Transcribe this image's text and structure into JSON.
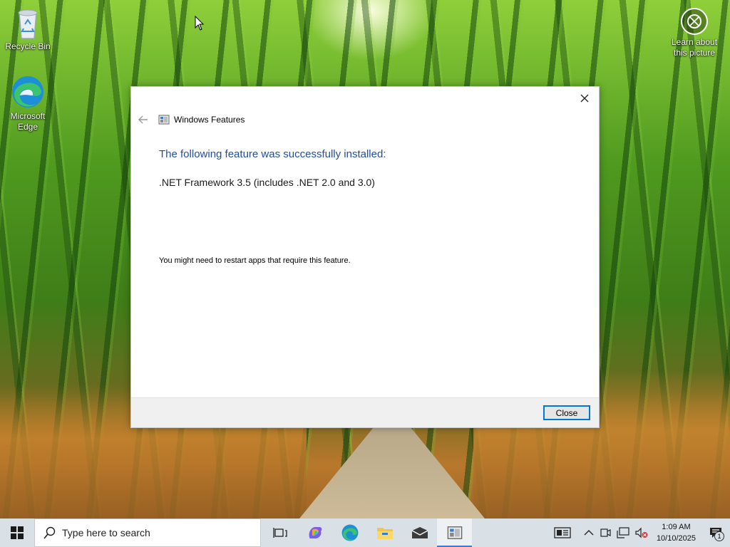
{
  "desktop": {
    "icons": [
      {
        "label": "Recycle Bin",
        "icon": "recycle-bin-icon"
      },
      {
        "label": "Microsoft Edge",
        "icon": "edge-icon"
      }
    ],
    "learn_label": "Learn about this picture",
    "learn_icon": "camera-icon"
  },
  "dialog": {
    "title": "Windows Features",
    "heading": "The following feature was successfully installed:",
    "feature": ".NET Framework 3.5 (includes .NET 2.0 and 3.0)",
    "note": "You might need to restart apps that require this feature.",
    "close_button": "Close",
    "heading_color": "#1f4e9a",
    "button_border_color": "#0078d7"
  },
  "taskbar": {
    "search_placeholder": "Type here to search",
    "apps": [
      {
        "name": "task-view-icon",
        "active": false
      },
      {
        "name": "copilot-icon",
        "active": false
      },
      {
        "name": "edge-icon",
        "active": false
      },
      {
        "name": "file-explorer-icon",
        "active": false
      },
      {
        "name": "mail-icon",
        "active": false
      },
      {
        "name": "windows-features-icon",
        "active": true
      }
    ],
    "time": "1:09 AM",
    "date": "10/10/2025",
    "notification_count": "1",
    "tray_icons": [
      "news-icon",
      "chevron-up-icon",
      "meet-icon",
      "network-icon",
      "volume-muted-icon",
      "action-center-icon"
    ]
  }
}
